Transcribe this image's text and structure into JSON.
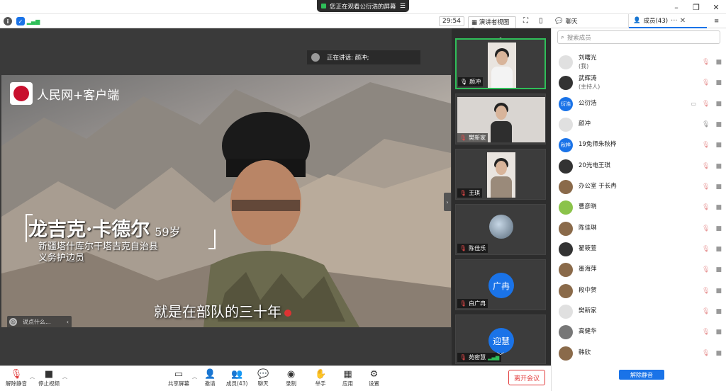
{
  "titlebar": {
    "share_status": "您正在观看公衍浩的屏幕"
  },
  "toolbar": {
    "timer": "29:54",
    "view_mode": "演讲者视图"
  },
  "main": {
    "speaking_label": "正在讲话: 颜冲;",
    "video": {
      "logo_text": "人民网+客户端",
      "person_name": "龙吉克·卡德尔",
      "person_age": "59岁",
      "place_line1": "新疆塔什库尔干塔吉克自治县",
      "place_line2": "义务护边员",
      "subtitle": "就是在部队的三十年"
    },
    "comment_placeholder": "说点什么..."
  },
  "gallery": {
    "tiles": [
      {
        "name": "颜冲",
        "active": true,
        "mic": "on"
      },
      {
        "name": "樊新家",
        "active": false,
        "mic": "off"
      },
      {
        "name": "王琪",
        "active": false,
        "mic": "off"
      },
      {
        "name": "陈佳乐",
        "active": false,
        "mic": "off"
      },
      {
        "name": "白广冉",
        "active": false,
        "mic": "off",
        "avatar": "广冉"
      },
      {
        "name": "苑密慧",
        "active": false,
        "mic": "off",
        "avatar": "迎慧"
      }
    ]
  },
  "right_panel": {
    "tab_chat": "聊天",
    "tab_members": "成员(43)",
    "search_placeholder": "搜索成员",
    "members": [
      {
        "name": "刘曙光",
        "sub": "(我)"
      },
      {
        "name": "武辉涛",
        "sub": "(主持人)"
      },
      {
        "name": "公衍浩",
        "avatar": "衍浩"
      },
      {
        "name": "颜冲"
      },
      {
        "name": "19免师朱秋桦",
        "avatar": "秋桦"
      },
      {
        "name": "20光电王琪"
      },
      {
        "name": "办公室 于长冉"
      },
      {
        "name": "曹彦晓"
      },
      {
        "name": "陈佳琳"
      },
      {
        "name": "翟筱萱"
      },
      {
        "name": "墨海萍"
      },
      {
        "name": "段中贺"
      },
      {
        "name": "樊新家"
      },
      {
        "name": "高健华"
      },
      {
        "name": "韩欣"
      }
    ],
    "unmute_all": "解除静音"
  },
  "bottombar": {
    "unmute": "解除静音",
    "stop_video": "停止视频",
    "share_screen": "共享屏幕",
    "invite": "邀请",
    "members": "成员(43)",
    "chat": "聊天",
    "record": "录制",
    "raise_hand": "举手",
    "apps": "应用",
    "settings": "设置",
    "leave": "离开会议"
  },
  "colors": {
    "accent": "#1a73e8",
    "active_tile": "#2fbf59",
    "leave": "#e23b3b"
  }
}
